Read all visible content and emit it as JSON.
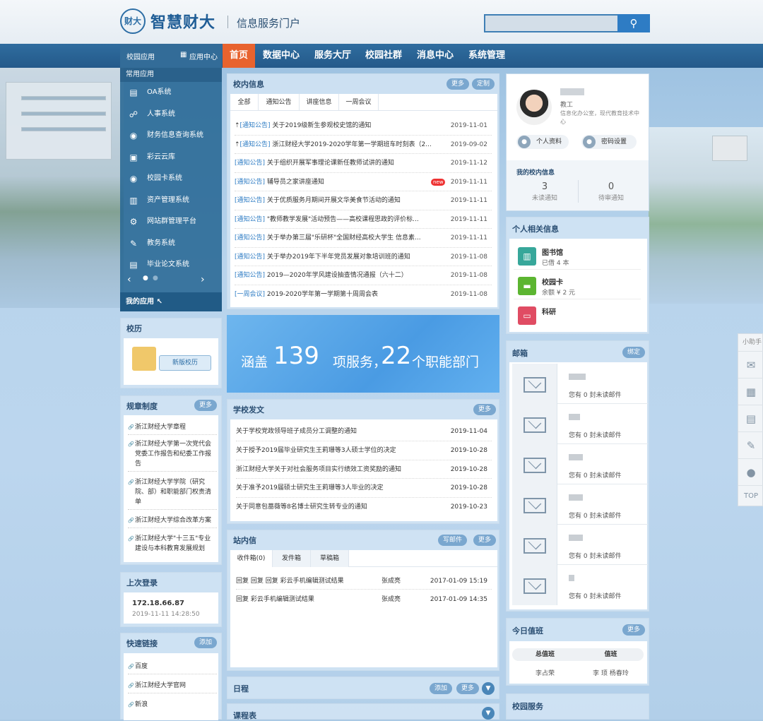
{
  "header": {
    "logo_mark": "财大",
    "logo_text": "智慧财大",
    "portal_name": "信息服务门户"
  },
  "nav": {
    "campus_apps": "校园应用",
    "app_center": "应用中心",
    "items": [
      "首页",
      "数据中心",
      "服务大厅",
      "校园社群",
      "消息中心",
      "系统管理"
    ]
  },
  "sidebar": {
    "common_apps": "常用应用",
    "items": [
      {
        "label": "OA系统",
        "icon": "doc-icon"
      },
      {
        "label": "人事系统",
        "icon": "people-icon"
      },
      {
        "label": "财务信息查询系统",
        "icon": "finance-icon"
      },
      {
        "label": "彩云云库",
        "icon": "cloud-icon"
      },
      {
        "label": "校园卡系统",
        "icon": "card-icon"
      },
      {
        "label": "资产管理系统",
        "icon": "asset-icon"
      },
      {
        "label": "网站群管理平台",
        "icon": "gear-icon"
      },
      {
        "label": "教务系统",
        "icon": "edu-icon"
      },
      {
        "label": "毕业论文系统",
        "icon": "thesis-icon"
      }
    ],
    "my_apps": "我的应用"
  },
  "calendar": {
    "title": "校历",
    "button": "新版校历"
  },
  "rules": {
    "title": "规章制度",
    "more": "更多",
    "items": [
      "浙江财经大学章程",
      "浙江财经大学第一次党代会党委工作报告和纪委工作报告",
      "浙江财经大学学院（研究院、部）和职能部门权责清单",
      "浙江财经大学综合改革方案",
      "浙江财经大学\"十三五\"专业建设与本科教育发展规划"
    ]
  },
  "last_login": {
    "title": "上次登录",
    "ip": "172.18.66.87",
    "time": "2019-11-11 14:28:50"
  },
  "quick_links": {
    "title": "快速链接",
    "add": "添加",
    "items": [
      "百度",
      "浙江财经大学官网",
      "新浪"
    ]
  },
  "campus_info": {
    "title": "校内信息",
    "more": "更多",
    "custom": "定制",
    "tabs": [
      "全部",
      "通知公告",
      "讲座信息",
      "一周会议"
    ],
    "rows": [
      {
        "tag": "[通知公告]",
        "text": "关于2019级新生参观校史馆的通知",
        "date": "2019-11-01",
        "pinned": true
      },
      {
        "tag": "[通知公告]",
        "text": "浙江财经大学2019-2020学年第一学期班车时刻表（2...",
        "date": "2019-09-02",
        "pinned": true
      },
      {
        "tag": "[通知公告]",
        "text": "关于组织开展军事理论课新任教师试讲的通知",
        "date": "2019-11-12",
        "pinned": false
      },
      {
        "tag": "[通知公告]",
        "text": "辅导员之家讲座通知",
        "date": "2019-11-11",
        "pinned": false,
        "badge": "new"
      },
      {
        "tag": "[通知公告]",
        "text": "关于优质服务月期间开展文华美食节活动的通知",
        "date": "2019-11-11",
        "pinned": false
      },
      {
        "tag": "[通知公告]",
        "text": "\"教师教学发展\"活动预告——高校课程思政的评价标...",
        "date": "2019-11-11",
        "pinned": false
      },
      {
        "tag": "[通知公告]",
        "text": "关于举办第三届\"乐研杯\"全国财经高校大学生 信息素...",
        "date": "2019-11-11",
        "pinned": false
      },
      {
        "tag": "[通知公告]",
        "text": "关于举办2019年下半年党员发展对象培训班的通知",
        "date": "2019-11-08",
        "pinned": false
      },
      {
        "tag": "[通知公告]",
        "text": "2019—2020年学风建设抽查情况通报（六十二）",
        "date": "2019-11-08",
        "pinned": false
      },
      {
        "tag": "[一周会议]",
        "text": "2019-2020学年第一学期第十周周会表",
        "date": "2019-11-08",
        "pinned": false
      }
    ]
  },
  "banner": {
    "p1": "涵盖",
    "n1": "139",
    "p2": "项服务，",
    "n2": "22",
    "p3": "个职能部门"
  },
  "school_docs": {
    "title": "学校发文",
    "more": "更多",
    "rows": [
      {
        "text": "关于学校党政领导班子成员分工调整的通知",
        "date": "2019-11-04"
      },
      {
        "text": "关于授予2019届毕业研究生王莉珊等3人硕士学位的决定",
        "date": "2019-10-28"
      },
      {
        "text": "浙江财经大学关于对社会服务项目实行绩效工资奖励的通知",
        "date": "2019-10-28"
      },
      {
        "text": "关于准予2019届硕士研究生王莉珊等3人毕业的决定",
        "date": "2019-10-28"
      },
      {
        "text": "关于同意包蔷薇等8名博士研究生转专业的通知",
        "date": "2019-10-23"
      }
    ]
  },
  "site_mail": {
    "title": "站内信",
    "write": "写邮件",
    "more": "更多",
    "tabs": [
      "收件箱(0)",
      "发件箱",
      "草稿箱"
    ],
    "rows": [
      {
        "subject": "回复 回复 回复 彩云手机编辑测试结果",
        "sender": "张成亮",
        "time": "2017-01-09  15:19"
      },
      {
        "subject": "回复 彩云手机编辑测试结果",
        "sender": "张成亮",
        "time": "2017-01-09  14:35"
      }
    ]
  },
  "schedule": {
    "title": "日程",
    "add": "添加",
    "more": "更多"
  },
  "timetable": {
    "title": "课程表"
  },
  "profile": {
    "role": "教工",
    "dept": "信息化办公室，现代教育技术中心",
    "btn_info": "个人资料",
    "btn_pwd": "密码设置",
    "my_info": "我的校内信息",
    "unread": "3",
    "unread_label": "未读通知",
    "pending": "0",
    "pending_label": "待审通知"
  },
  "personal": {
    "title": "个人相关信息",
    "items": [
      {
        "name": "图书馆",
        "detail": "已借 4 本",
        "color": "#37a79a"
      },
      {
        "name": "校园卡",
        "detail": "余额 ¥    2 元",
        "color": "#5cb531"
      },
      {
        "name": "科研",
        "detail": "",
        "color": "#e04c63"
      }
    ]
  },
  "mailbox": {
    "title": "邮箱",
    "setting": "绑定",
    "count_text": "您有  0  封未读邮件"
  },
  "duty": {
    "title": "今日值班",
    "more": "更多",
    "col1": "总值班",
    "col2": "值班",
    "name1": "李占荣",
    "name2": "李 顼 杨春玲"
  },
  "campus_service": {
    "title": "校园服务"
  },
  "float": {
    "title": "小助手",
    "top": "TOP"
  }
}
